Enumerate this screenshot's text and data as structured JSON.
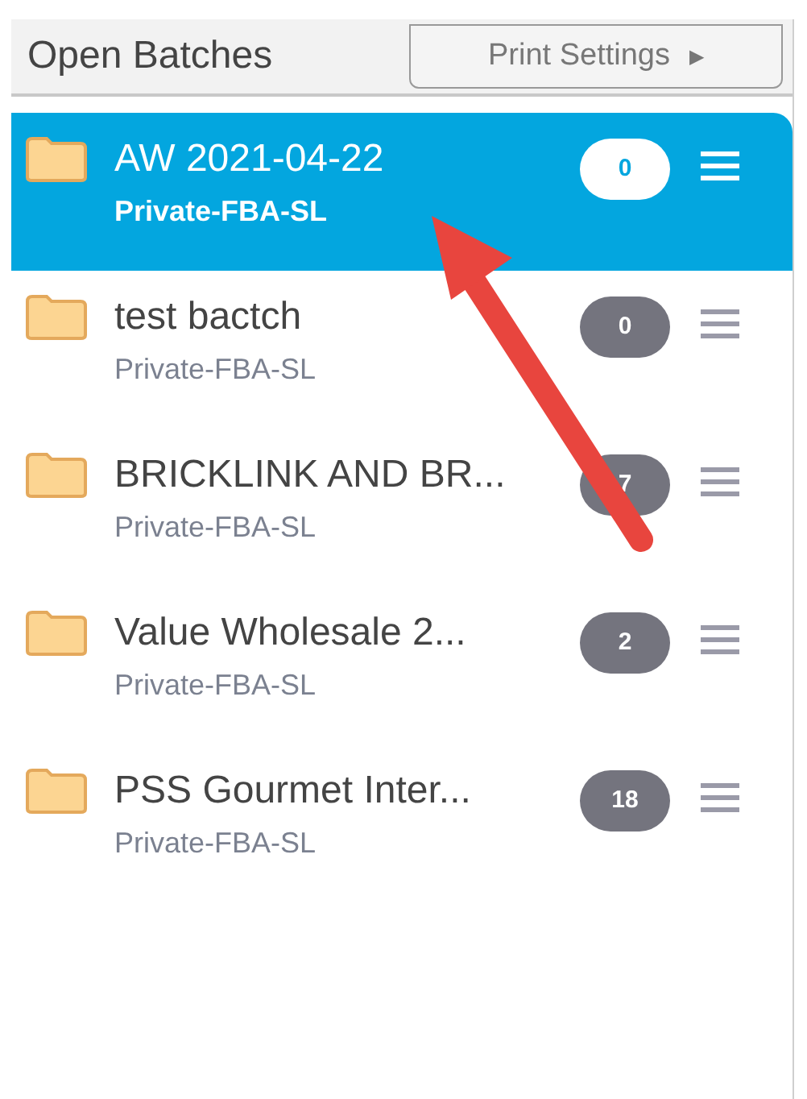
{
  "header": {
    "title": "Open Batches",
    "print_settings": "Print Settings",
    "print_settings_caret": "▶"
  },
  "batches": [
    {
      "name": "AW 2021-04-22",
      "subtitle": "Private-FBA-SL",
      "count": "0",
      "selected": true
    },
    {
      "name": "test bactch",
      "subtitle": "Private-FBA-SL",
      "count": "0",
      "selected": false
    },
    {
      "name": "BRICKLINK AND BR...",
      "subtitle": "Private-FBA-SL",
      "count": "7",
      "selected": false
    },
    {
      "name": "Value Wholesale 2...",
      "subtitle": "Private-FBA-SL",
      "count": "2",
      "selected": false
    },
    {
      "name": "PSS Gourmet Inter...",
      "subtitle": "Private-FBA-SL",
      "count": "18",
      "selected": false
    }
  ]
}
